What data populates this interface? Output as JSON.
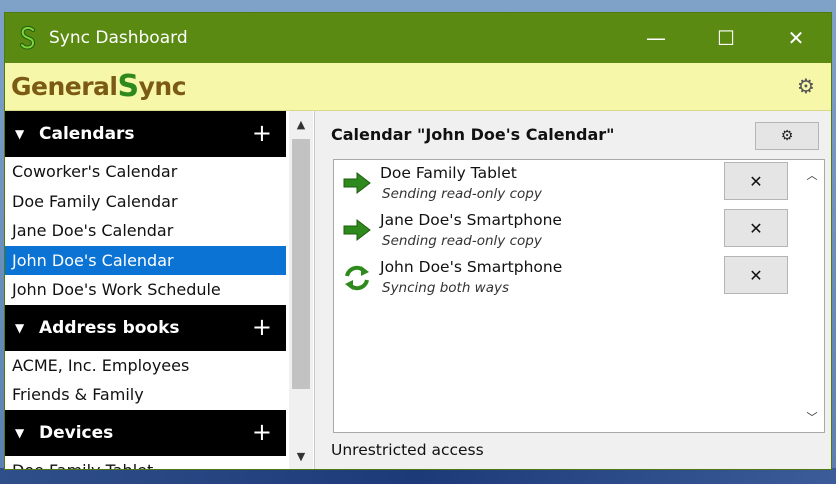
{
  "window": {
    "title": "Sync Dashboard",
    "controls": {
      "minimize": "—",
      "maximize": "☐",
      "close": "✕"
    }
  },
  "brand": {
    "name_prefix": "General",
    "name_s": "S",
    "name_suffix": "ync",
    "settings_icon": "gear-icon"
  },
  "sidebar": {
    "sections": [
      {
        "title": "Calendars",
        "items": [
          "Coworker's Calendar",
          "Doe Family Calendar",
          "Jane Doe's Calendar",
          "John Doe's Calendar",
          "John Doe's Work Schedule"
        ],
        "selected_index": 3
      },
      {
        "title": "Address books",
        "items": [
          "ACME, Inc. Employees",
          "Friends & Family"
        ]
      },
      {
        "title": "Devices",
        "items": [
          "Doe Family Tablet"
        ]
      }
    ],
    "add_glyph": "+",
    "collapse_glyph": "▼"
  },
  "main": {
    "title": "Calendar \"John Doe's Calendar\"",
    "settings_glyph": "⚙",
    "devices": [
      {
        "name": "Doe Family Tablet",
        "status": "Sending read-only copy",
        "icon": "arrow-right-icon"
      },
      {
        "name": "Jane Doe's Smartphone",
        "status": "Sending read-only copy",
        "icon": "arrow-right-icon"
      },
      {
        "name": "John Doe's Smartphone",
        "status": "Syncing both ways",
        "icon": "sync-arrows-icon"
      }
    ],
    "remove_glyph": "✕",
    "footer": "Unrestricted access"
  },
  "colors": {
    "titlebar": "#5a8a12",
    "brandbar": "#f6f7a8",
    "selection": "#0a73d4",
    "section_header": "#000000",
    "arrow_green": "#2f8a1d"
  }
}
